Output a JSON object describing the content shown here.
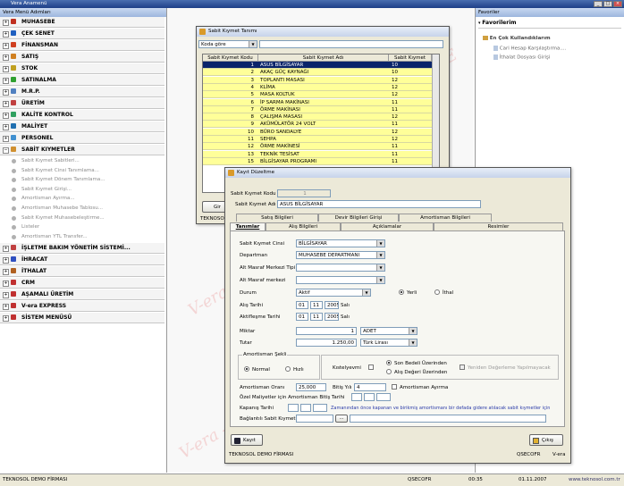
{
  "titlebar": {
    "title": "Vera Anamenü"
  },
  "left_menu": {
    "header": "Vera Menü Adımları",
    "modules": [
      {
        "label": "MUHASEBE",
        "color": "#c03020"
      },
      {
        "label": "ÇEK SENET",
        "color": "#2060c0"
      },
      {
        "label": "FİNANSMAN",
        "color": "#d04020"
      },
      {
        "label": "SATIŞ",
        "color": "#d08020"
      },
      {
        "label": "STOK",
        "color": "#c0a020"
      },
      {
        "label": "SATINALMA",
        "color": "#30a030"
      },
      {
        "label": "M.R.P.",
        "color": "#5080c0"
      },
      {
        "label": "ÜRETİM",
        "color": "#c04040"
      },
      {
        "label": "KALİTE KONTROL",
        "color": "#30a060"
      },
      {
        "label": "MALİYET",
        "color": "#2070b0"
      },
      {
        "label": "PERSONEL",
        "color": "#4090d0"
      },
      {
        "label": "SABİT KIYMETLER",
        "color": "#d09030"
      }
    ],
    "sub_items": [
      "Sabit Kıymet Sabitleri...",
      "Sabit Kıymet Cinsi Tanımlama...",
      "Sabit Kıymet Dönem Tanımlama...",
      "Sabit Kıymet Girişi...",
      "Amortisman Ayırma...",
      "Amortisman Muhasebe Tablosu...",
      "Sabit Kıymet Muhasebeleştirme...",
      "Listeler",
      "Amortisman YTL Transfer..."
    ],
    "modules2": [
      {
        "label": "İŞLETME BAKIM YÖNETİM SİSTEMİ...",
        "color": "#c04040"
      },
      {
        "label": "İHRACAT",
        "color": "#3050c0"
      },
      {
        "label": "İTHALAT",
        "color": "#b06020"
      },
      {
        "label": "CRM",
        "color": "#c03030"
      },
      {
        "label": "AŞAMALI ÜRETİM",
        "color": "#c03030"
      },
      {
        "label": "V-era EXPRESS",
        "color": "#c03030"
      },
      {
        "label": "SİSTEM MENÜSÜ",
        "color": "#c03030"
      }
    ]
  },
  "favorites": {
    "header": "Favoriler",
    "section": "Favorilerim",
    "group": "En Çok Kullandıklarım",
    "items": [
      "Cari Hesap Karşılaştırma....",
      "İthalat Dosyası Girişi"
    ]
  },
  "watermark": "V-era - E",
  "status": {
    "company": "TEKNOSOL DEMO FİRMASI",
    "user": "QSECOFR",
    "time": "00:35",
    "date": "01.11.2007",
    "url": "www.teknosol.com.tr"
  },
  "table_window": {
    "title": "Sabit Kıymet Tanımı",
    "sort_combo": "Koda göre",
    "columns": [
      "Sabit Kıymet Kodu",
      "Sabit Kıymet Adı",
      "Sabit Kıymet Cinsi"
    ],
    "rows": [
      [
        "1",
        "ASUS BİLGİSAYAR",
        "10"
      ],
      [
        "2",
        "AKAÇ GÜÇ KAYNAĞI",
        "10"
      ],
      [
        "3",
        "TOPLANTI MASASI",
        "12"
      ],
      [
        "4",
        "KLİMA",
        "12"
      ],
      [
        "5",
        "MASA KOLTUK",
        "12"
      ],
      [
        "6",
        "İP SARMA MAKİNASI",
        "11"
      ],
      [
        "7",
        "ÖRME MAKİNASI",
        "11"
      ],
      [
        "8",
        "ÇALIŞMA MASASI",
        "12"
      ],
      [
        "9",
        "AKÜMÜLATÖR 24 VOLT",
        "11"
      ],
      [
        "10",
        "BÜRO SANDALYE",
        "12"
      ],
      [
        "11",
        "SEHPA",
        "12"
      ],
      [
        "12",
        "ÖRME MAKİNESİ",
        "11"
      ],
      [
        "13",
        "TEKNİK TESİSAT",
        "11"
      ],
      [
        "15",
        "BİLGİSAYAR PROGRAMI",
        "11"
      ]
    ],
    "footer": "TEKNOSOL"
  },
  "edit_window": {
    "title": "Kayıt Düzeltme",
    "code_label": "Sabit Kıymet Kodu",
    "code_value": "1",
    "name_label": "Sabit Kıymet Adı",
    "name_value": "ASUS BİLGİSAYAR",
    "tabs_row1": [
      "Satış Bilgileri",
      "Devir Bilgileri Girişi",
      "Amortisman Bilgileri"
    ],
    "tabs_row2": [
      "Tanımlar",
      "Alış Bilgileri",
      "Açıklamalar",
      "Resimler"
    ],
    "fields": {
      "cins_label": "Sabit Kıymet Cinsi",
      "cins_value": "BİLGİSAYAR",
      "dept_label": "Departman",
      "dept_value": "MUHASEBE DEPARTMANI",
      "alt_tipi_label": "Alt Masraf Merkezi Tipi",
      "alt_merkez_label": "Alt Masraf merkezi",
      "durum_label": "Durum",
      "durum_value": "Aktif",
      "yerli": "Yerli",
      "ithal": "İthal",
      "alis_label": "Alış Tarihi",
      "aktif_label": "Aktifleşme Tarihi",
      "date_day": "01",
      "date_month": "11",
      "date_year": "2005",
      "date_day_name": "Salı",
      "miktar_label": "Miktar",
      "miktar_value": "1",
      "birim_value": "ADET",
      "tutar_label": "Tutar",
      "tutar_value": "1.250,00",
      "doviz_value": "Türk Lirası"
    },
    "amort": {
      "group_label": "Amortisman Şekli",
      "normal": "Normal",
      "hizli": "Hızlı",
      "kist": "Kıstelyevmi",
      "son_bedel": "Son Bedeli Üzerinden",
      "alis_degeri": "Alış Değeri Üzerinden",
      "yeniden": "Yeniden Değerleme Yapılmayacak",
      "oran_label": "Amortisman Oranı",
      "oran_value": "25,000",
      "bitis_label": "Bitiş Yılı",
      "bitis_value": "4",
      "ayirma_label": "Amortisman Ayırma",
      "ozel_label": "Özel Maliyetler için Amortisman Bitiş Tarihi",
      "kapanis_label": "Kapanış Tarihi",
      "kapanis_note": "Zamanından önce kapanan ve birikmiş amortismanı bir defada gidere atılacak sabit kıymetler için",
      "bagli_label": "Bağlantılı Sabit Kıymet",
      "bagli_btn": "..."
    },
    "buttons": {
      "save": "Kayıt",
      "exit": "Çıkış"
    },
    "footer": {
      "company": "TEKNOSOL DEMO FİRMASI",
      "user": "QSECOFR",
      "app": "V-era"
    }
  }
}
